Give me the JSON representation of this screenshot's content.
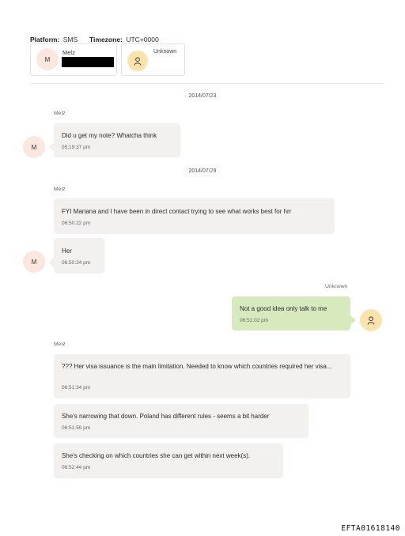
{
  "header": {
    "platform_label": "Platform:",
    "platform_value": "SMS",
    "timezone_label": "Timezone:",
    "timezone_value": "UTC+0000"
  },
  "participants": [
    {
      "initial": "M",
      "name": "Melz",
      "redacted": true
    },
    {
      "icon": "person-icon",
      "name": "Unknown"
    }
  ],
  "conversation": [
    {
      "type": "date",
      "text": "2014/07/23"
    },
    {
      "type": "message",
      "sender": "Melz",
      "text": "Did u get my note? Whatcha think",
      "time": "05:19:37 pm"
    },
    {
      "type": "date",
      "text": "2014/07/29"
    },
    {
      "type": "message",
      "sender": "Melz",
      "text": "FYI Mariana and I have been in direct contact trying to see what works best for hrr",
      "time": "06:50:22 pm"
    },
    {
      "type": "message",
      "sender": "Melz",
      "text": "Her",
      "time": "06:50:24 pm"
    },
    {
      "type": "message",
      "sender": "Unknown",
      "text": "Not a good idea only talk to me",
      "time": "06:51:02 pm"
    },
    {
      "type": "message",
      "sender": "Melz",
      "text": "??? Her visa issuance is the main limitation. Needed to know which countries required her visa...",
      "time": "06:51:34 pm"
    },
    {
      "type": "message",
      "sender": "Melz",
      "text": "She's narrowing that down. Poland has different rules - seems a bit harder",
      "time": "06:51:59 pm"
    },
    {
      "type": "message",
      "sender": "Melz",
      "text": "She's checking on which countries she can get within next week(s).",
      "time": "06:52:44 pm"
    }
  ],
  "avatar_initial": "M",
  "footer_id": "EFTA01618140",
  "colors": {
    "incoming_bubble": "#f3f1f0",
    "outgoing_bubble": "#d7eabe",
    "melz_avatar": "#fbe7df",
    "unknown_avatar": "#fbe4ab"
  }
}
